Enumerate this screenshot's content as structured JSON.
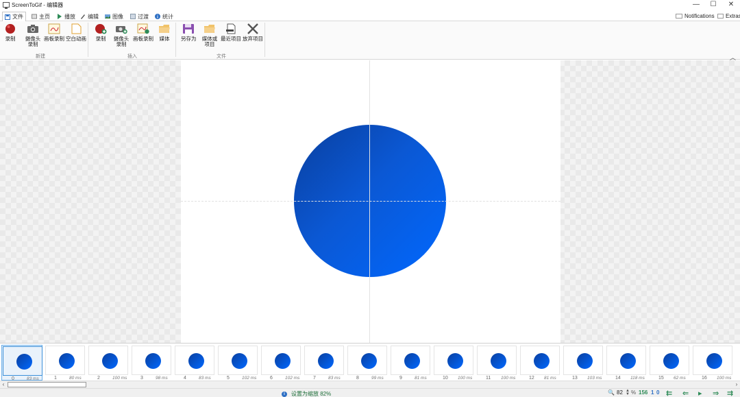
{
  "window": {
    "title": "ScreenToGif - 编辑器",
    "controls": [
      "—",
      "☐",
      "✕"
    ]
  },
  "tabs": [
    {
      "label": "文件",
      "icon": "save-icon",
      "active": true
    },
    {
      "label": "主页",
      "icon": "home-icon"
    },
    {
      "label": "播放",
      "icon": "play-icon"
    },
    {
      "label": "编辑",
      "icon": "pencil-icon"
    },
    {
      "label": "图像",
      "icon": "image-icon"
    },
    {
      "label": "过渡",
      "icon": "transition-icon"
    },
    {
      "label": "统计",
      "icon": "info-icon"
    }
  ],
  "toplinks": {
    "notifications": "Notifications",
    "extras": "Extras"
  },
  "ribbon": {
    "groups": [
      {
        "label": "新建",
        "buttons": [
          "录制",
          "摄像头\n录制",
          "画板录制",
          "空白动画"
        ]
      },
      {
        "label": "插入",
        "buttons": [
          "录制",
          "摄像头\n录制",
          "画板录制",
          "媒体"
        ]
      },
      {
        "label": "文件",
        "buttons": [
          "另存为",
          "媒体或\n项目",
          "最近项目",
          "放弃项目"
        ]
      }
    ]
  },
  "filmstrip": {
    "frames": [
      {
        "index": "0",
        "ms": "83 ms",
        "selected": true
      },
      {
        "index": "1",
        "ms": "80 ms"
      },
      {
        "index": "2",
        "ms": "100 ms"
      },
      {
        "index": "3",
        "ms": "98 ms"
      },
      {
        "index": "4",
        "ms": "83 ms"
      },
      {
        "index": "5",
        "ms": "102 ms"
      },
      {
        "index": "6",
        "ms": "102 ms"
      },
      {
        "index": "7",
        "ms": "83 ms"
      },
      {
        "index": "8",
        "ms": "99 ms"
      },
      {
        "index": "9",
        "ms": "81 ms"
      },
      {
        "index": "10",
        "ms": "100 ms"
      },
      {
        "index": "11",
        "ms": "100 ms"
      },
      {
        "index": "12",
        "ms": "81 ms"
      },
      {
        "index": "13",
        "ms": "103 ms"
      },
      {
        "index": "14",
        "ms": "118 ms"
      },
      {
        "index": "15",
        "ms": "62 ms"
      },
      {
        "index": "16",
        "ms": "100 ms"
      }
    ]
  },
  "status": {
    "message": "设置为缩放 82%",
    "zoom": "82",
    "percent": "%",
    "frame_count": "156",
    "selected_count": "1",
    "current_frame": "0"
  },
  "colors": {
    "accent": "#2d6fc4",
    "ball_start": "#0a3f9e",
    "ball_end": "#0068ff",
    "status_green": "#2e8b57"
  }
}
